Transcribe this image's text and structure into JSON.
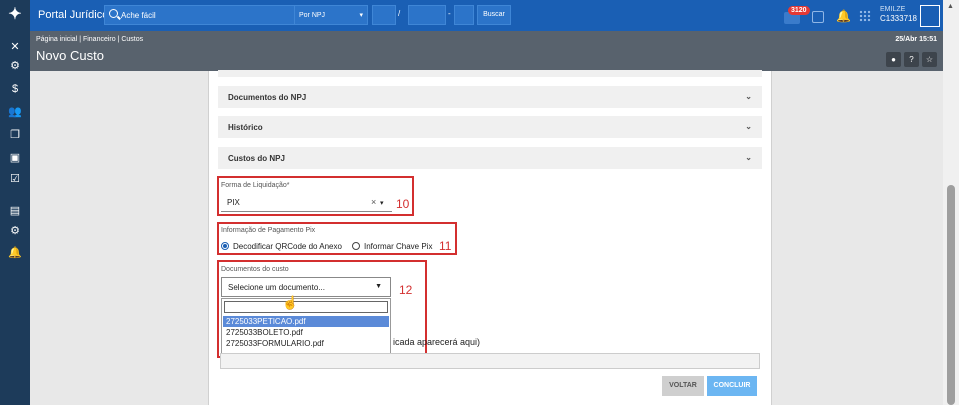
{
  "topbar": {
    "app_title": "Portal Jurídico",
    "search_placeholder": "Ache fácil",
    "npj_select": "Por NPJ",
    "npj_sep1": "/",
    "npj_sep2": "-",
    "buscar_label": "Buscar",
    "notification_count": "3120",
    "user_name": "EMILZE",
    "user_code": "C1333718"
  },
  "subheader": {
    "breadcrumb": "Página inicial | Financeiro | Custos",
    "title": "Novo Custo",
    "datetime": "25/Abr 15:51",
    "help_label": "?",
    "star_label": "☆"
  },
  "sidebar": {
    "icons": [
      "tools-icon",
      "gear-icon",
      "dollar-icon",
      "users-icon",
      "copy-icon",
      "chart-icon",
      "check-icon",
      "calendar-icon",
      "settings-icon",
      "bell-icon"
    ]
  },
  "accordions": [
    {
      "label": "Documentos do NPJ"
    },
    {
      "label": "Histórico"
    },
    {
      "label": "Custos do NPJ"
    }
  ],
  "form": {
    "forma_label": "Forma de Liquidação*",
    "forma_value": "PIX",
    "pix_label": "Informação de Pagamento Pix",
    "radio1": "Decodificar QRCode do Anexo",
    "radio2": "Informar Chave Pix",
    "docs_label": "Documentos do custo",
    "docs_placeholder": "Selecione um documento...",
    "docs_options": [
      "2725033PETICAO.pdf",
      "2725033BOLETO.pdf",
      "2725033FORMULARIO.pdf"
    ],
    "hidden_text": "icada aparecerá aqui)"
  },
  "annotations": {
    "a10": "10",
    "a11": "11",
    "a12": "12"
  },
  "buttons": {
    "voltar": "VOLTAR",
    "concluir": "CONCLUIR"
  }
}
